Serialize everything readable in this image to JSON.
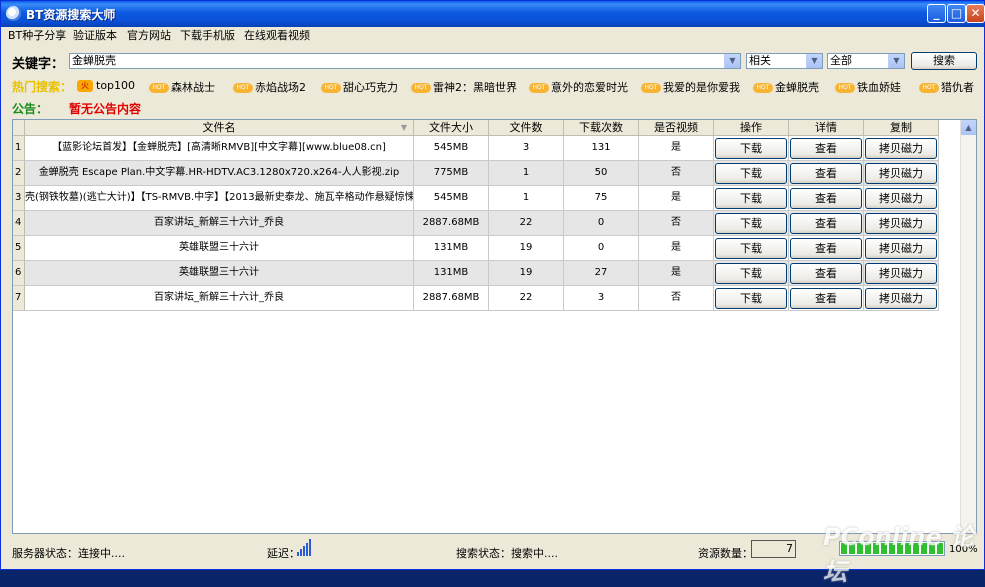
{
  "window": {
    "title": "BT资源搜索大师"
  },
  "menu": [
    "BT种子分享",
    "验证版本",
    "官方网站",
    "下载手机版",
    "在线观看视频"
  ],
  "search": {
    "label": "关键字：",
    "keyword": "金蝉脱壳",
    "sort": "相关",
    "category": "全部",
    "button": "搜索"
  },
  "hot": {
    "label": "热门搜索：",
    "badge_fire": "火",
    "badge_hot": "HOT",
    "tags": [
      "top100",
      "森林战士",
      "赤焰战场2",
      "甜心巧克力",
      "雷神2：黑暗世界",
      "意外的恋爱时光",
      "我爱的是你爱我",
      "金蝉脱壳",
      "铁血娇娃",
      "猎仇者"
    ]
  },
  "notice": {
    "label": "公告：",
    "text": "暂无公告内容"
  },
  "grid": {
    "columns": [
      "文件名",
      "文件大小",
      "文件数",
      "下载次数",
      "是否视频",
      "操作",
      "详情",
      "复制"
    ],
    "action_label": "下载",
    "detail_label": "查看",
    "copy_label": "拷贝磁力",
    "rows": [
      {
        "n": "1",
        "name": "【蓝影论坛首发】【金蝉脱壳】[高清晰RMVB][中文字幕][www.blue08.cn]",
        "size": "545MB",
        "files": "3",
        "downloads": "131",
        "video": "是"
      },
      {
        "n": "2",
        "name": "金蝉脱壳 Escape Plan.中文字幕.HR-HDTV.AC3.1280x720.x264-人人影视.zip",
        "size": "775MB",
        "files": "1",
        "downloads": "50",
        "video": "否"
      },
      {
        "n": "3",
        "name": "壳(钢铁牧墓)(逃亡大计)】【TS-RMVB.中字】【2013最新史泰龙、施瓦辛格动作悬疑惊悚",
        "size": "545MB",
        "files": "1",
        "downloads": "75",
        "video": "是"
      },
      {
        "n": "4",
        "name": "百家讲坛_新解三十六计_乔良",
        "size": "2887.68MB",
        "files": "22",
        "downloads": "0",
        "video": "否"
      },
      {
        "n": "5",
        "name": "英雄联盟三十六计",
        "size": "131MB",
        "files": "19",
        "downloads": "0",
        "video": "是"
      },
      {
        "n": "6",
        "name": "英雄联盟三十六计",
        "size": "131MB",
        "files": "19",
        "downloads": "27",
        "video": "是"
      },
      {
        "n": "7",
        "name": "百家讲坛_新解三十六计_乔良",
        "size": "2887.68MB",
        "files": "22",
        "downloads": "3",
        "video": "否"
      }
    ]
  },
  "status": {
    "server_label": "服务器状态：",
    "server_value": "连接中....",
    "latency_label": "延迟：",
    "search_label": "搜索状态：",
    "search_value": "搜索中....",
    "count_label": "资源数量：",
    "count_value": "7",
    "progress_percent": "100%",
    "progress_value": 1.0
  },
  "watermark": "PConline 论坛"
}
